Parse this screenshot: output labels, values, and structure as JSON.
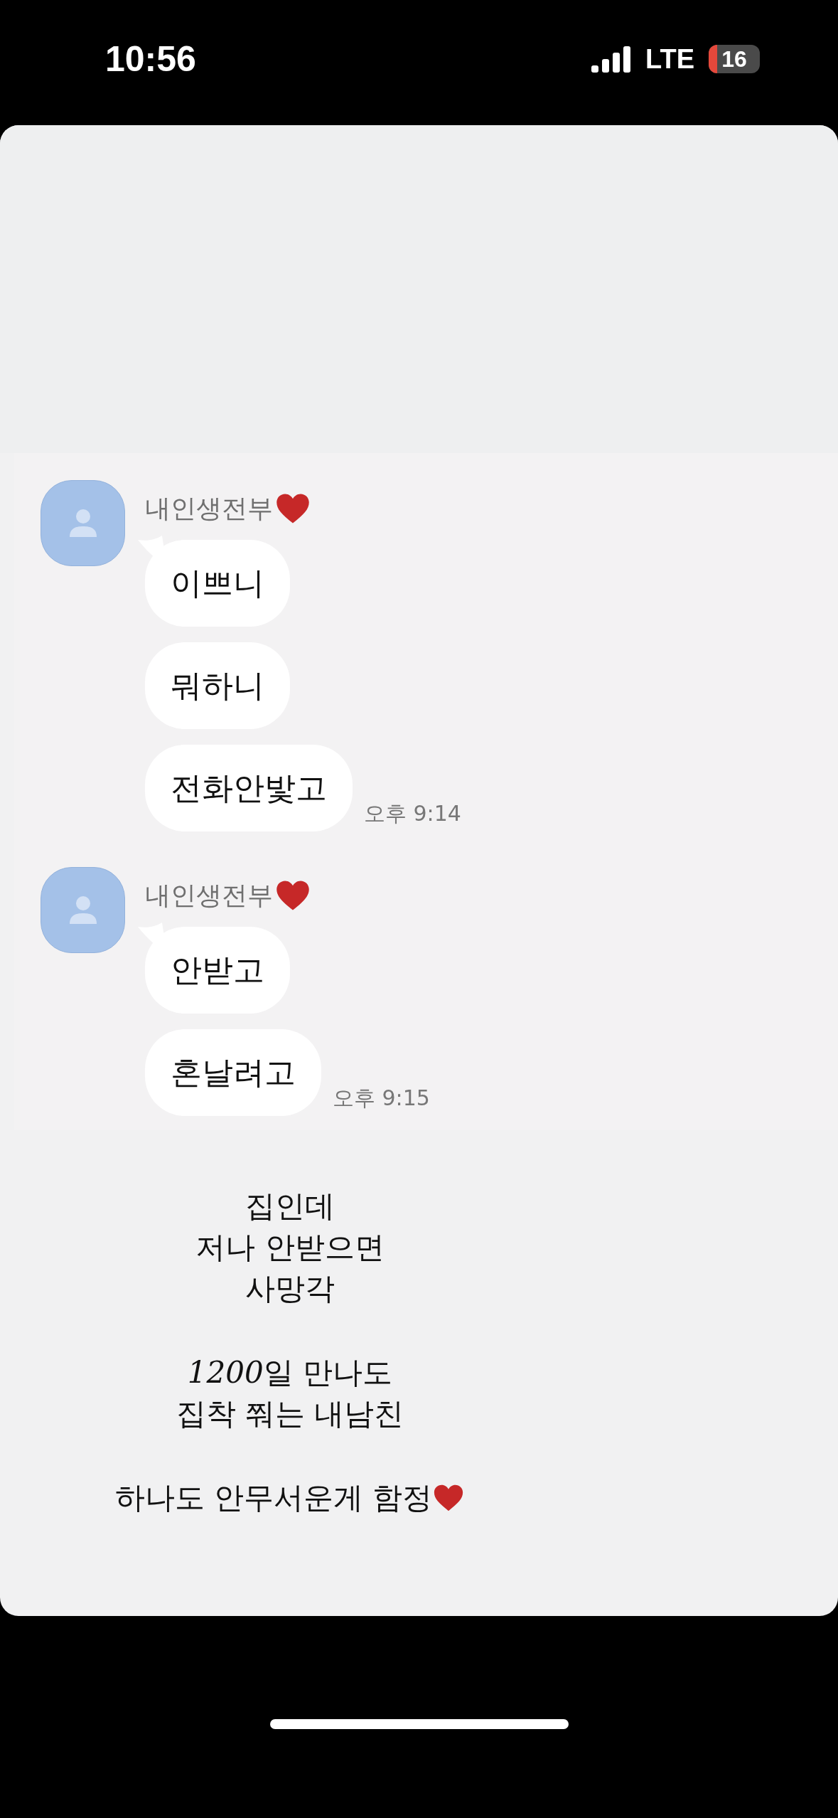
{
  "status_bar": {
    "time": "10:56",
    "network": "LTE",
    "battery": "16"
  },
  "chat": {
    "groups": [
      {
        "sender": "내인생전부",
        "messages": [
          "이쁘니",
          "뭐하니",
          "전화안밫고"
        ],
        "time": "오후 9:14"
      },
      {
        "sender": "내인생전부",
        "messages": [
          "안받고",
          "혼날려고"
        ],
        "time": "오후 9:15"
      }
    ]
  },
  "caption": [
    [
      "집인데",
      "저나 안받으면",
      "사망각"
    ],
    [
      {
        "italic": "1200",
        "text": "일 만나도"
      },
      "집착 쭤는 내남친"
    ],
    [
      "하나도 안무서운게 함정"
    ]
  ]
}
